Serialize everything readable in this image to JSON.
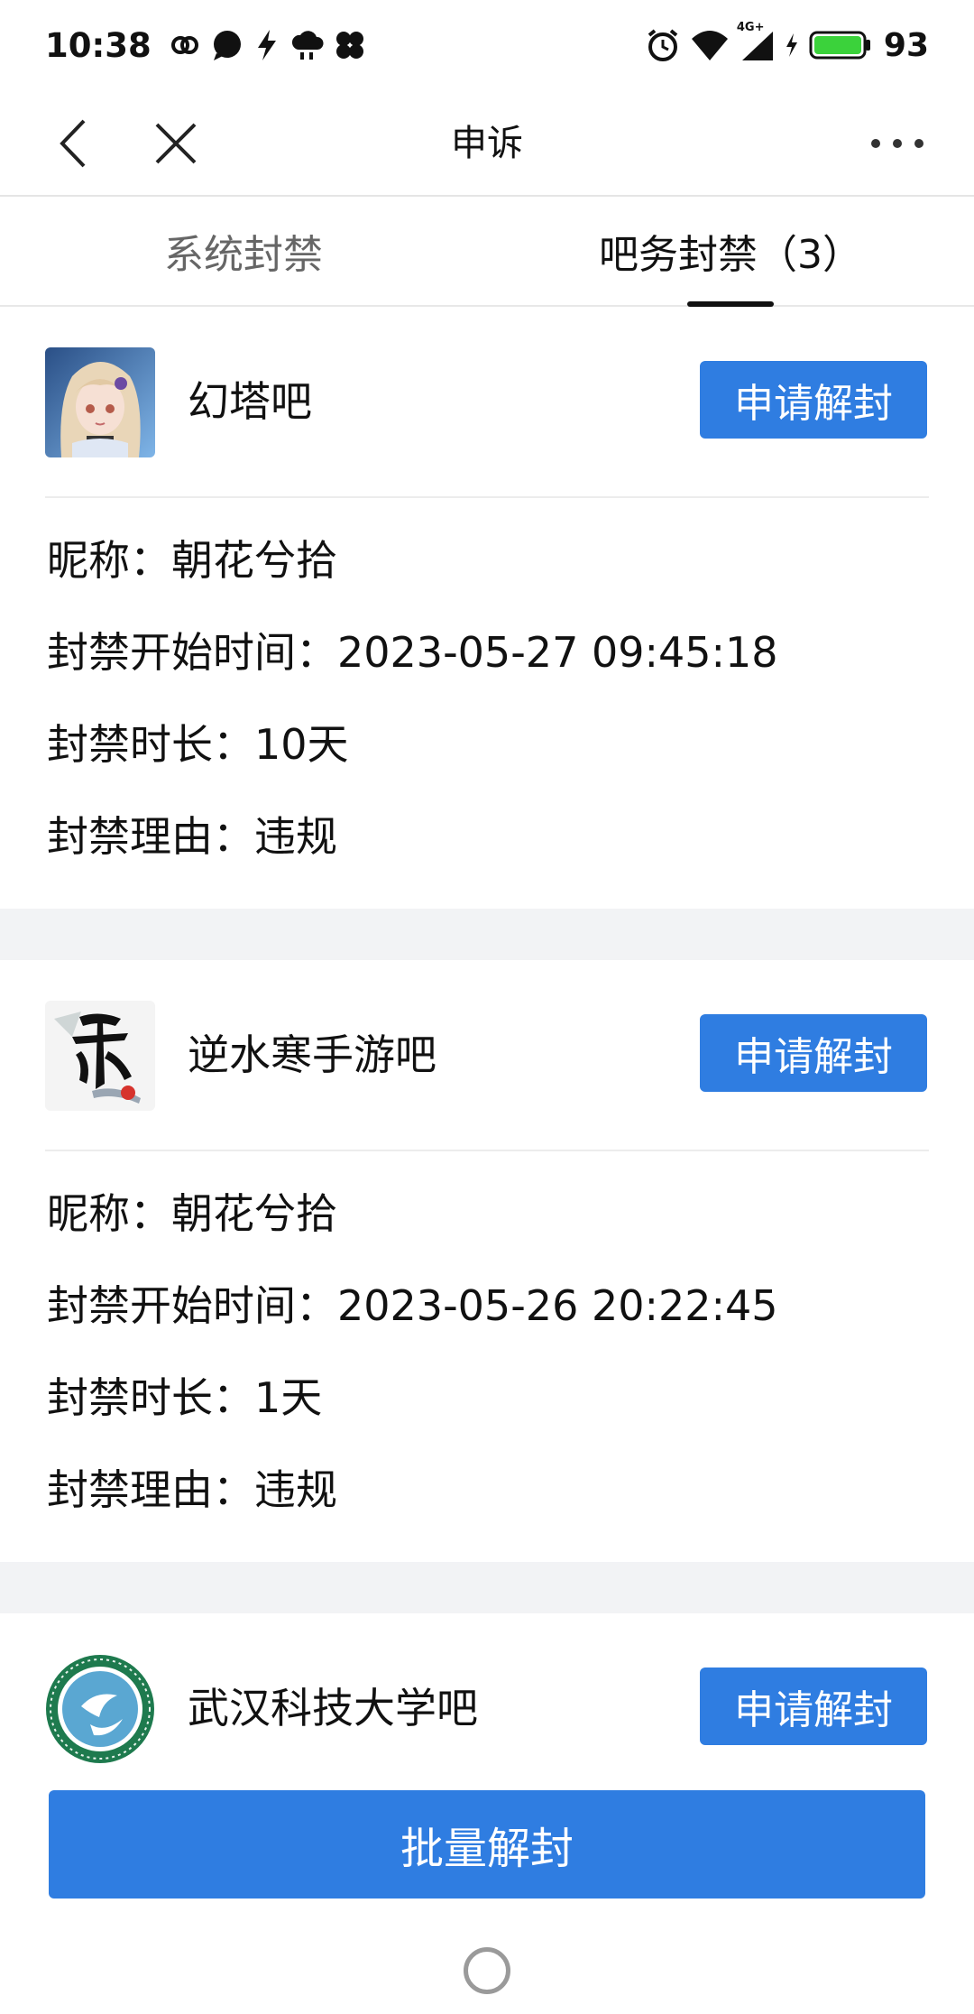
{
  "status_bar": {
    "time": "10:38",
    "battery_percent": "93",
    "network": "4G+",
    "icons": [
      "link-icon",
      "message-icon",
      "bolt-icon",
      "cloud-rain-icon",
      "clover-icon",
      "alarm-icon",
      "wifi-icon",
      "signal-icon",
      "charging-icon",
      "battery-icon"
    ]
  },
  "nav": {
    "title": "申诉"
  },
  "tabs": [
    {
      "label": "系统封禁",
      "active": false
    },
    {
      "label": "吧务封禁（3）",
      "active": true
    }
  ],
  "cards": [
    {
      "forum": "幻塔吧",
      "button": "申请解封",
      "nickname": "昵称：朝花兮拾",
      "start": "封禁开始时间：2023-05-27 09:45:18",
      "duration": "封禁时长：10天",
      "reason": "封禁理由：违规"
    },
    {
      "forum": "逆水寒手游吧",
      "button": "申请解封",
      "nickname": "昵称：朝花兮拾",
      "start": "封禁开始时间：2023-05-26 20:22:45",
      "duration": "封禁时长：1天",
      "reason": "封禁理由：违规"
    },
    {
      "forum": "武汉科技大学吧",
      "button": "申请解封"
    }
  ],
  "bottom": {
    "batch_label": "批量解封"
  },
  "colors": {
    "accent": "#2f7de1",
    "battery": "#3bd23b"
  }
}
